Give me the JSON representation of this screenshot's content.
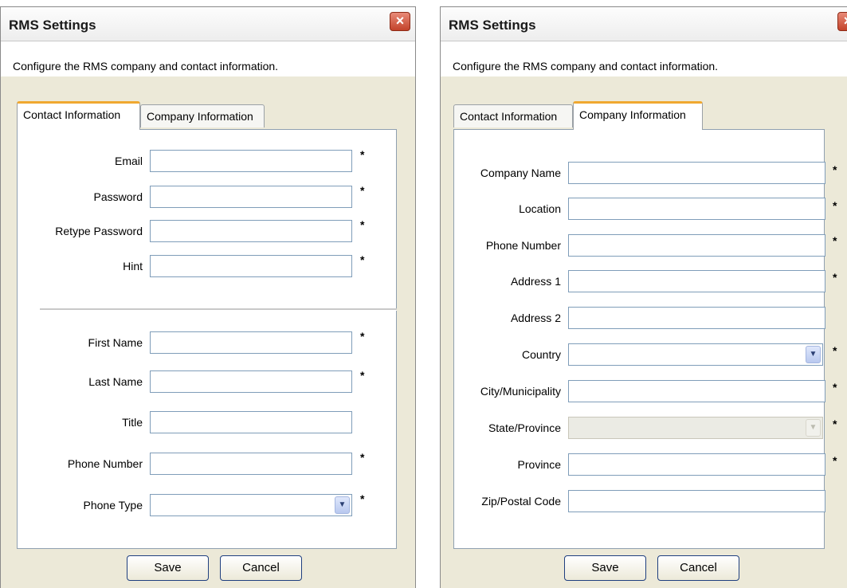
{
  "left_dialog": {
    "title": "RMS Settings",
    "close_glyph": "×",
    "description": "Configure the RMS company and contact information.",
    "tabs": [
      {
        "label": "Contact Information",
        "active": true
      },
      {
        "label": "Company Information",
        "active": false
      }
    ],
    "fields_upper": [
      {
        "label": "Email",
        "value": "",
        "required": true
      },
      {
        "label": "Password",
        "value": "",
        "required": true
      },
      {
        "label": "Retype Password",
        "value": "",
        "required": true
      },
      {
        "label": "Hint",
        "value": "",
        "required": true
      }
    ],
    "fields_lower": [
      {
        "label": "First Name",
        "value": "",
        "required": true
      },
      {
        "label": "Last Name",
        "value": "",
        "required": true
      },
      {
        "label": "Title",
        "value": "",
        "required": false
      },
      {
        "label": "Phone Number",
        "value": "",
        "required": true
      },
      {
        "label": "Phone Type",
        "value": "",
        "required": true,
        "type": "select"
      }
    ],
    "save_label": "Save",
    "cancel_label": "Cancel"
  },
  "right_dialog": {
    "title": "RMS Settings",
    "close_glyph": "×",
    "description": "Configure the RMS company and contact information.",
    "tabs": [
      {
        "label": "Contact Information",
        "active": false
      },
      {
        "label": "Company Information",
        "active": true
      }
    ],
    "fields": [
      {
        "label": "Company Name",
        "value": "",
        "required": true
      },
      {
        "label": "Location",
        "value": "",
        "required": true
      },
      {
        "label": "Phone Number",
        "value": "",
        "required": true
      },
      {
        "label": "Address 1",
        "value": "",
        "required": true
      },
      {
        "label": "Address 2",
        "value": "",
        "required": false
      },
      {
        "label": "Country",
        "value": "",
        "required": true,
        "type": "select"
      },
      {
        "label": "City/Municipality",
        "value": "",
        "required": true
      },
      {
        "label": "State/Province",
        "value": "",
        "required": true,
        "type": "select",
        "disabled": true
      },
      {
        "label": "Province",
        "value": "",
        "required": true
      },
      {
        "label": "Zip/Postal Code",
        "value": "",
        "required": false
      }
    ],
    "save_label": "Save",
    "cancel_label": "Cancel"
  },
  "required_marker": "*",
  "dropdown_icon": "chevron-down-icon",
  "colors": {
    "dialog_bg": "#ece9d8",
    "close_button": "#c3432b",
    "active_tab_accent": "#f0a830",
    "field_border": "#7f9db9"
  }
}
